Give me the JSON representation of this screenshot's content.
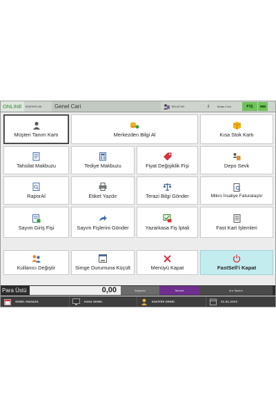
{
  "topbar": {
    "status": "ONLINE",
    "customer_label": "MÜŞTERİ ADI",
    "title": "Genel Cari",
    "user": "BELGE NO",
    "number": "2",
    "receipt_label": "Belge Cinsi",
    "receipt_type": "FİŞ"
  },
  "buttons": [
    {
      "label": "Müşteri Tanım Kartı",
      "icon": "person-icon"
    },
    {
      "label": "Merkezden Bilgi Al",
      "icon": "coins-icon"
    },
    {
      "label": "Kısa Stok Kartı",
      "icon": "box-icon"
    },
    {
      "label": "Tahsilat Makbuzu",
      "icon": "document-icon"
    },
    {
      "label": "Tediye Makbuzu",
      "icon": "calculator-icon"
    },
    {
      "label": "Fiyat Değişiklik Fişi",
      "icon": "tag-icon"
    },
    {
      "label": "Depo Sevk",
      "icon": "transfer-icon"
    },
    {
      "label": "RaporAl",
      "icon": "report-icon"
    },
    {
      "label": "Etiket Yazdır",
      "icon": "printer-icon"
    },
    {
      "label": "Terazi Bilgi Gönder",
      "icon": "scale-icon"
    },
    {
      "label": "Mikro İrsaliye Faturalaştır",
      "icon": "invoice-icon"
    },
    {
      "label": "Sayım Giriş Fişi",
      "icon": "count-entry-icon"
    },
    {
      "label": "Sayım Fişlerini Gönder",
      "icon": "send-arrow-icon"
    },
    {
      "label": "Yazarkasa Fiş İptali",
      "icon": "cash-register-icon"
    },
    {
      "label": "Fast Kart İşlemleri",
      "icon": "card-list-icon"
    },
    {
      "label": "Kullanıcı Değiştir",
      "icon": "switch-user-icon"
    },
    {
      "label": "Simge Durumuna Küçült",
      "icon": "minimize-icon"
    },
    {
      "label": "Menüyü Kapat",
      "icon": "close-icon"
    },
    {
      "label": "FastSell'i Kapat",
      "icon": "power-icon"
    }
  ],
  "paybar": {
    "label": "Para Üstü",
    "value": "0,00",
    "cell1": "Kapanan",
    "cell2": "Tahsilat",
    "cell3": "Ara Toplam"
  },
  "statusbar": {
    "store": "GENEL MAGAZA",
    "register": "KASA GENEL",
    "cashier": "KASİYER GENEL",
    "date": "31.01.2023"
  },
  "colors": {
    "online": "#2f8a2f",
    "exit_button": "#c3ecef",
    "receipt_badge": "#6fc25a",
    "purple_cell": "#6e2f8e"
  }
}
